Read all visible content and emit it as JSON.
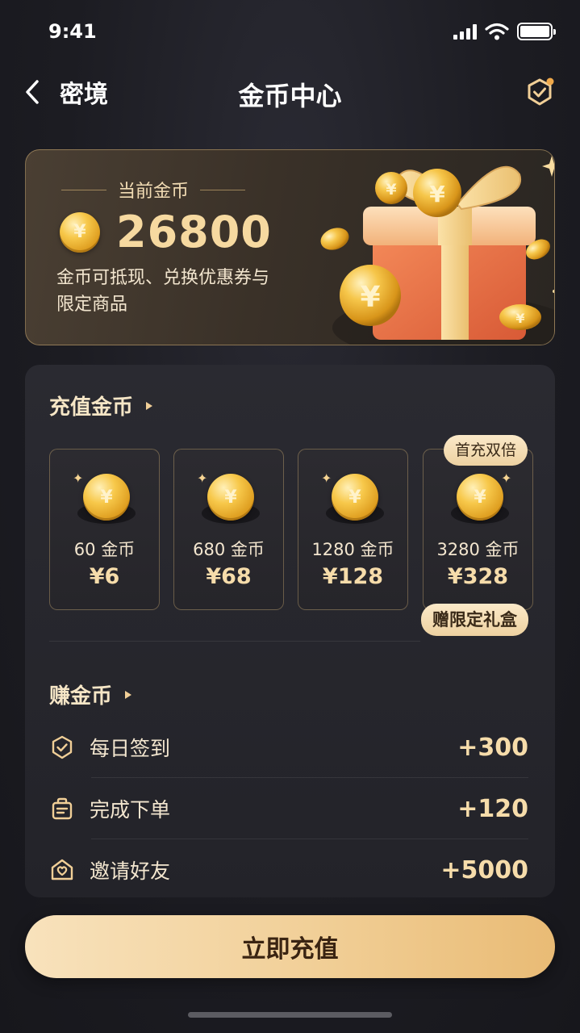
{
  "status_bar": {
    "time": "9:41"
  },
  "nav": {
    "back_label": "密境",
    "title": "金币中心"
  },
  "balance": {
    "label": "当前金币",
    "amount": "26800",
    "description": "金币可抵现、兑换优惠券与限定商品",
    "currency_symbol": "¥"
  },
  "recharge": {
    "title": "充值金币",
    "packages": [
      {
        "coins": "60 金币",
        "price": "¥6"
      },
      {
        "coins": "680 金币",
        "price": "¥68"
      },
      {
        "coins": "1280 金币",
        "price": "¥128"
      },
      {
        "coins": "3280 金币",
        "price": "¥328",
        "badge_top": "首充双倍",
        "badge_bottom": "赠限定礼盒"
      }
    ]
  },
  "earn": {
    "title": "赚金币",
    "tasks": [
      {
        "label": "每日签到",
        "reward": "+300",
        "icon": "check-shield-icon"
      },
      {
        "label": "完成下单",
        "reward": "+120",
        "icon": "order-bag-icon"
      },
      {
        "label": "邀请好友",
        "reward": "+5000",
        "icon": "invite-heart-icon"
      }
    ]
  },
  "cta": {
    "label": "立即充值"
  },
  "colors": {
    "accent": "#f1cf97",
    "gold": "#f6dcaa",
    "background": "#1c1c22"
  }
}
